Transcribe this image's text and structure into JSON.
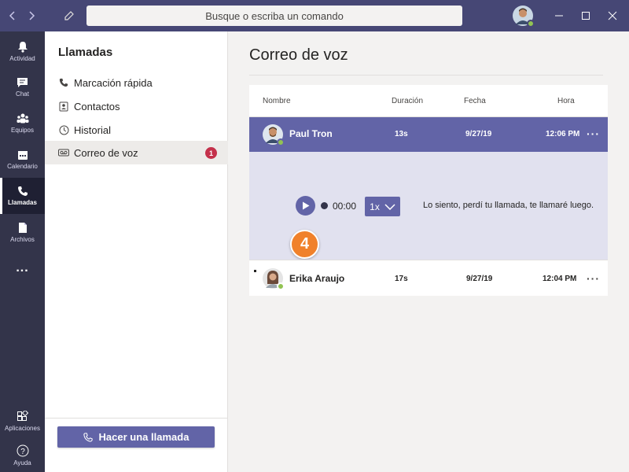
{
  "titlebar": {
    "search_placeholder": "Busque o escriba un comando"
  },
  "rail": {
    "items": [
      {
        "label": "Actividad",
        "icon": "bell-icon"
      },
      {
        "label": "Chat",
        "icon": "chat-icon"
      },
      {
        "label": "Equipos",
        "icon": "teams-icon"
      },
      {
        "label": "Calendario",
        "icon": "calendar-icon"
      },
      {
        "label": "Llamadas",
        "icon": "phone-icon",
        "active": true
      },
      {
        "label": "Archivos",
        "icon": "file-icon"
      },
      {
        "label": "...",
        "icon": "more-icon"
      }
    ],
    "bottom": [
      {
        "label": "Aplicaciones",
        "icon": "apps-icon"
      },
      {
        "label": "Ayuda",
        "icon": "help-icon"
      }
    ]
  },
  "left_panel": {
    "title": "Llamadas",
    "items": [
      {
        "label": "Marcación rápida",
        "icon": "phone-icon"
      },
      {
        "label": "Contactos",
        "icon": "contacts-icon"
      },
      {
        "label": "Historial",
        "icon": "history-icon"
      },
      {
        "label": "Correo de voz",
        "icon": "voicemail-icon",
        "badge": "1",
        "active": true
      }
    ],
    "call_button": "Hacer una llamada"
  },
  "main": {
    "title": "Correo de voz",
    "columns": [
      "Nombre",
      "Duración",
      "Fecha",
      "Hora"
    ],
    "rows": [
      {
        "name": "Paul Tron",
        "duration": "13s",
        "date": "9/27/19",
        "time": "12:06 PM",
        "more": "···"
      },
      {
        "name": "Erika Araujo",
        "duration": "17s",
        "date": "9/27/19",
        "time": "12:04 PM",
        "more": "···"
      }
    ],
    "player": {
      "time": "00:00",
      "speed": "1x",
      "transcript": "Lo siento, perdí tu llamada, te llamaré luego."
    },
    "step_badge": "4"
  },
  "colors": {
    "brand": "#6264a7",
    "titlebar": "#464775",
    "rail": "#33344a",
    "badge": "#c4314b",
    "step": "#f0812b"
  }
}
